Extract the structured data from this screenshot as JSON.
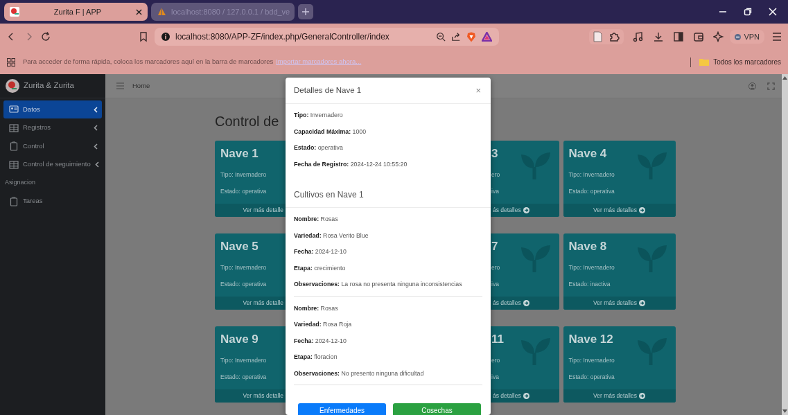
{
  "browser": {
    "tabs": [
      {
        "title": "Zurita F | APP",
        "selected": true
      },
      {
        "title": "localhost:8080 / 127.0.0.1 / bdd_ve",
        "selected": false
      }
    ],
    "address": "localhost:8080/APP-ZF/index.php/GeneralController/index",
    "vpn_label": "VPN",
    "bookmarks_bar": {
      "message": "Para acceder de forma rápida, coloca los marcadores aquí en la barra de marcadores",
      "link": "Importar marcadores ahora...",
      "all_bookmarks": "Todos los marcadores"
    }
  },
  "sidebar": {
    "brand": "Zurita & Zurita",
    "items": [
      {
        "kind": "link",
        "label": "Datos",
        "selected": true,
        "submenu": true
      },
      {
        "kind": "link",
        "label": "Registros",
        "selected": false,
        "submenu": true
      },
      {
        "kind": "link",
        "label": "Control",
        "selected": false,
        "submenu": true
      },
      {
        "kind": "link",
        "label": "Control de seguimiento",
        "selected": false,
        "submenu": true
      },
      {
        "kind": "header",
        "label": "Asignacion"
      },
      {
        "kind": "link",
        "label": "Tareas",
        "selected": false,
        "submenu": false
      }
    ]
  },
  "navbar": {
    "breadcrumb": "Home"
  },
  "content": {
    "title": "Control de",
    "cards": [
      {
        "kind": "covered_right",
        "title": "Nave 1",
        "lines": [
          "Tipo: Invernadero",
          "Estado: operativa"
        ],
        "footer": "Ver más detalle"
      },
      {
        "kind": "covered_left",
        "title": "3",
        "lines": [
          "ero",
          "iva"
        ],
        "footer": "ás detalles"
      },
      {
        "kind": "full",
        "title": "Nave 4",
        "lines": [
          "Tipo: Invernadero",
          "Estado: operativa"
        ],
        "footer": "Ver más detalles"
      },
      {
        "kind": "covered_right",
        "title": "Nave 5",
        "lines": [
          "Tipo: Invernadero",
          "Estado: operativa"
        ],
        "footer": "Ver más detalle"
      },
      {
        "kind": "covered_left",
        "title": "7",
        "lines": [
          "ero",
          "iva"
        ],
        "footer": "ás detalles"
      },
      {
        "kind": "full",
        "title": "Nave 8",
        "lines": [
          "Tipo: Invernadero",
          "Estado: inactiva"
        ],
        "footer": "Ver más detalles"
      },
      {
        "kind": "covered_right",
        "title": "Nave 9",
        "lines": [
          "Tipo: Invernadero",
          "Estado: operativa"
        ],
        "footer": "Ver más detalle"
      },
      {
        "kind": "covered_left",
        "title": "11",
        "lines": [
          "ero",
          "iva"
        ],
        "footer": "ás detalles"
      },
      {
        "kind": "full",
        "title": "Nave 12",
        "lines": [
          "Tipo: Invernadero",
          "Estado: operativa"
        ],
        "footer": "Ver más detalles"
      }
    ]
  },
  "modal": {
    "title": "Detalles de Nave 1",
    "close_label": "×",
    "fields": [
      "**Tipo:** Invernadero",
      "**Capacidad Máxima:** 1000",
      "**Estado:** operativa",
      "**Fecha de Registro:** 2024-12-24 10:55:20"
    ],
    "section_title": "Cultivos en Nave 1",
    "crops": [
      [
        "**Nombre:** Rosas",
        "**Variedad:** Rosa Verito Blue",
        "**Fecha:** 2024-12-10",
        "**Etapa:** crecimiento",
        "**Observaciones:** La rosa no presenta ninguna inconsistencias"
      ],
      [
        "**Nombre:** Rosas",
        "**Variedad:** Rosa Roja",
        "**Fecha:** 2024-12-10",
        "**Etapa:** floracion",
        "**Observaciones:** No presento ninguna dificultad"
      ]
    ],
    "buttons": [
      {
        "label": "Enfermedades",
        "kind": "primary"
      },
      {
        "label": "Cosechas",
        "kind": "success"
      }
    ]
  }
}
